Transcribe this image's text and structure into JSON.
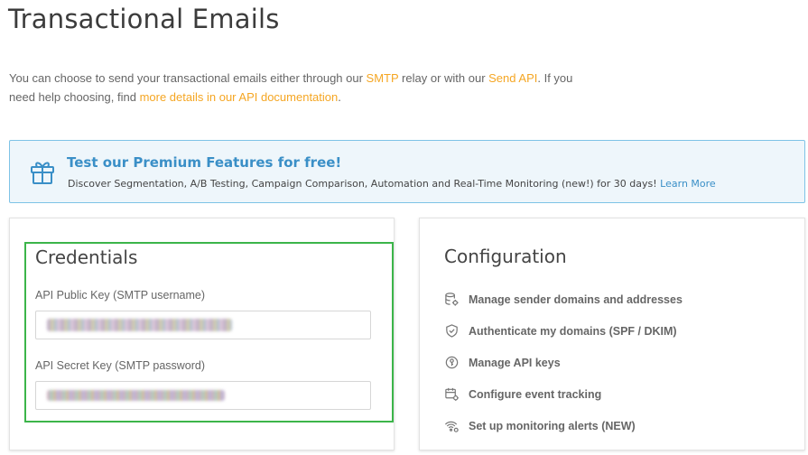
{
  "page": {
    "title": "Transactional Emails"
  },
  "intro": {
    "t1": "You can choose to send your transactional emails either through our ",
    "link_smtp": "SMTP",
    "t2": " relay or with our ",
    "link_api": "Send API",
    "t3": ". If you need help choosing, find ",
    "link_docs": "more details in our API documentation",
    "t4": "."
  },
  "promo": {
    "title": "Test our Premium Features for free!",
    "text": "Discover Segmentation, A/B Testing, Campaign Comparison, Automation and Real-Time Monitoring (new!) for 30 days! ",
    "link": "Learn More",
    "icon": "gift-icon"
  },
  "credentials": {
    "title": "Credentials",
    "public_label": "API Public Key (SMTP username)",
    "secret_label": "API Secret Key (SMTP password)"
  },
  "configuration": {
    "title": "Configuration",
    "items": [
      {
        "label": "Manage sender domains and addresses",
        "icon": "database-gear-icon"
      },
      {
        "label": "Authenticate my domains (SPF / DKIM)",
        "icon": "shield-check-icon"
      },
      {
        "label": "Manage API keys",
        "icon": "key-circle-icon"
      },
      {
        "label": "Configure event tracking",
        "icon": "calendar-gear-icon"
      },
      {
        "label": "Set up monitoring alerts (NEW)",
        "icon": "signal-gear-icon"
      }
    ]
  },
  "colors": {
    "link_orange": "#f5a623",
    "link_blue": "#3a8fc7",
    "highlight_green": "#3cb54a"
  }
}
